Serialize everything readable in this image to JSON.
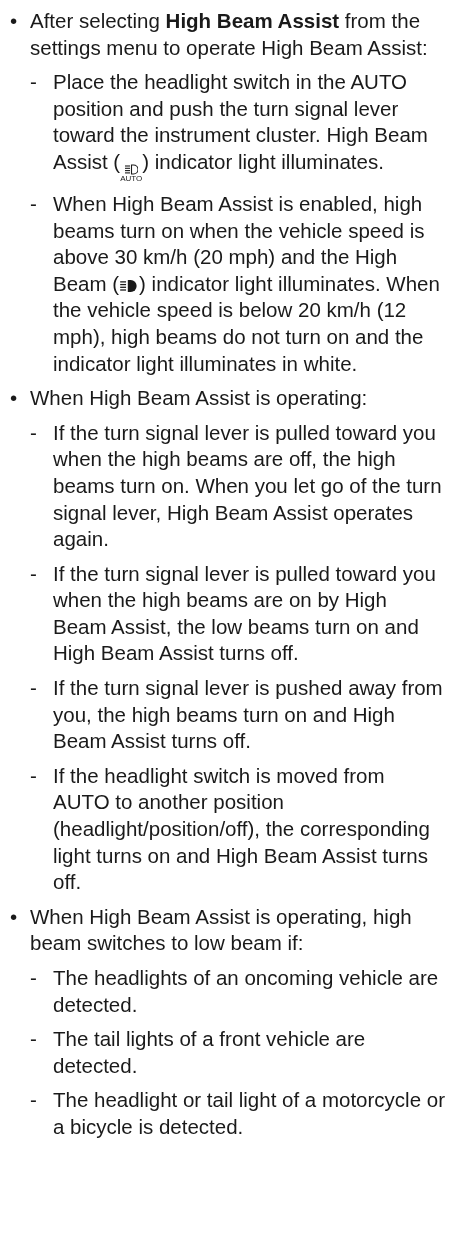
{
  "items": [
    {
      "bullet": "•",
      "segments": [
        {
          "kind": "text",
          "text": "After selecting **High Beam Assist** from the settings menu to operate High Beam Assist:"
        }
      ],
      "children": [
        {
          "bullet": "-",
          "segments": [
            {
              "kind": "text",
              "text": "Place the headlight switch in the AUTO position and push the turn signal lever toward the instrument cluster. High Beam Assist ("
            },
            {
              "kind": "auto_beam",
              "label": "AUTO"
            },
            {
              "kind": "text",
              "text": ") indicator light illuminates."
            }
          ]
        },
        {
          "bullet": "-",
          "segments": [
            {
              "kind": "text",
              "text": "When High Beam Assist is enabled, high beams turn on when the vehicle speed is above 30 km/h (20 mph) and the High Beam ("
            },
            {
              "kind": "high_beam"
            },
            {
              "kind": "text",
              "text": ") indicator light illuminates. When the vehicle speed is below 20 km/h (12 mph), high beams do not turn on and the indicator light illuminates in white."
            }
          ]
        }
      ]
    },
    {
      "bullet": "•",
      "segments": [
        {
          "kind": "text",
          "text": "When High Beam Assist is operating:"
        }
      ],
      "children": [
        {
          "bullet": "-",
          "segments": [
            {
              "kind": "text",
              "text": "If the turn signal lever is pulled toward you when the high beams are off, the high beams turn on. When you let go of the turn signal lever, High Beam Assist operates again."
            }
          ]
        },
        {
          "bullet": "-",
          "segments": [
            {
              "kind": "text",
              "text": "If the turn signal lever is pulled toward you when the high beams are on by High Beam Assist, the low beams turn on and High Beam Assist turns off."
            }
          ]
        },
        {
          "bullet": "-",
          "segments": [
            {
              "kind": "text",
              "text": "If the turn signal lever is pushed away from you, the high beams turn on and High Beam Assist turns off."
            }
          ]
        },
        {
          "bullet": "-",
          "segments": [
            {
              "kind": "text",
              "text": "If the headlight switch is moved from AUTO to another position (headlight/position/off), the corresponding light turns on and High Beam Assist turns off."
            }
          ]
        }
      ]
    },
    {
      "bullet": "•",
      "segments": [
        {
          "kind": "text",
          "text": "When High Beam Assist is operating, high beam switches to low beam if:"
        }
      ],
      "children": [
        {
          "bullet": "-",
          "segments": [
            {
              "kind": "text",
              "text": "The headlights of an oncoming vehicle are detected."
            }
          ]
        },
        {
          "bullet": "-",
          "segments": [
            {
              "kind": "text",
              "text": "The tail lights of a front vehicle are detected."
            }
          ]
        },
        {
          "bullet": "-",
          "segments": [
            {
              "kind": "text",
              "text": "The headlight or tail light of a motorcycle or a bicycle is detected."
            }
          ]
        }
      ]
    }
  ]
}
